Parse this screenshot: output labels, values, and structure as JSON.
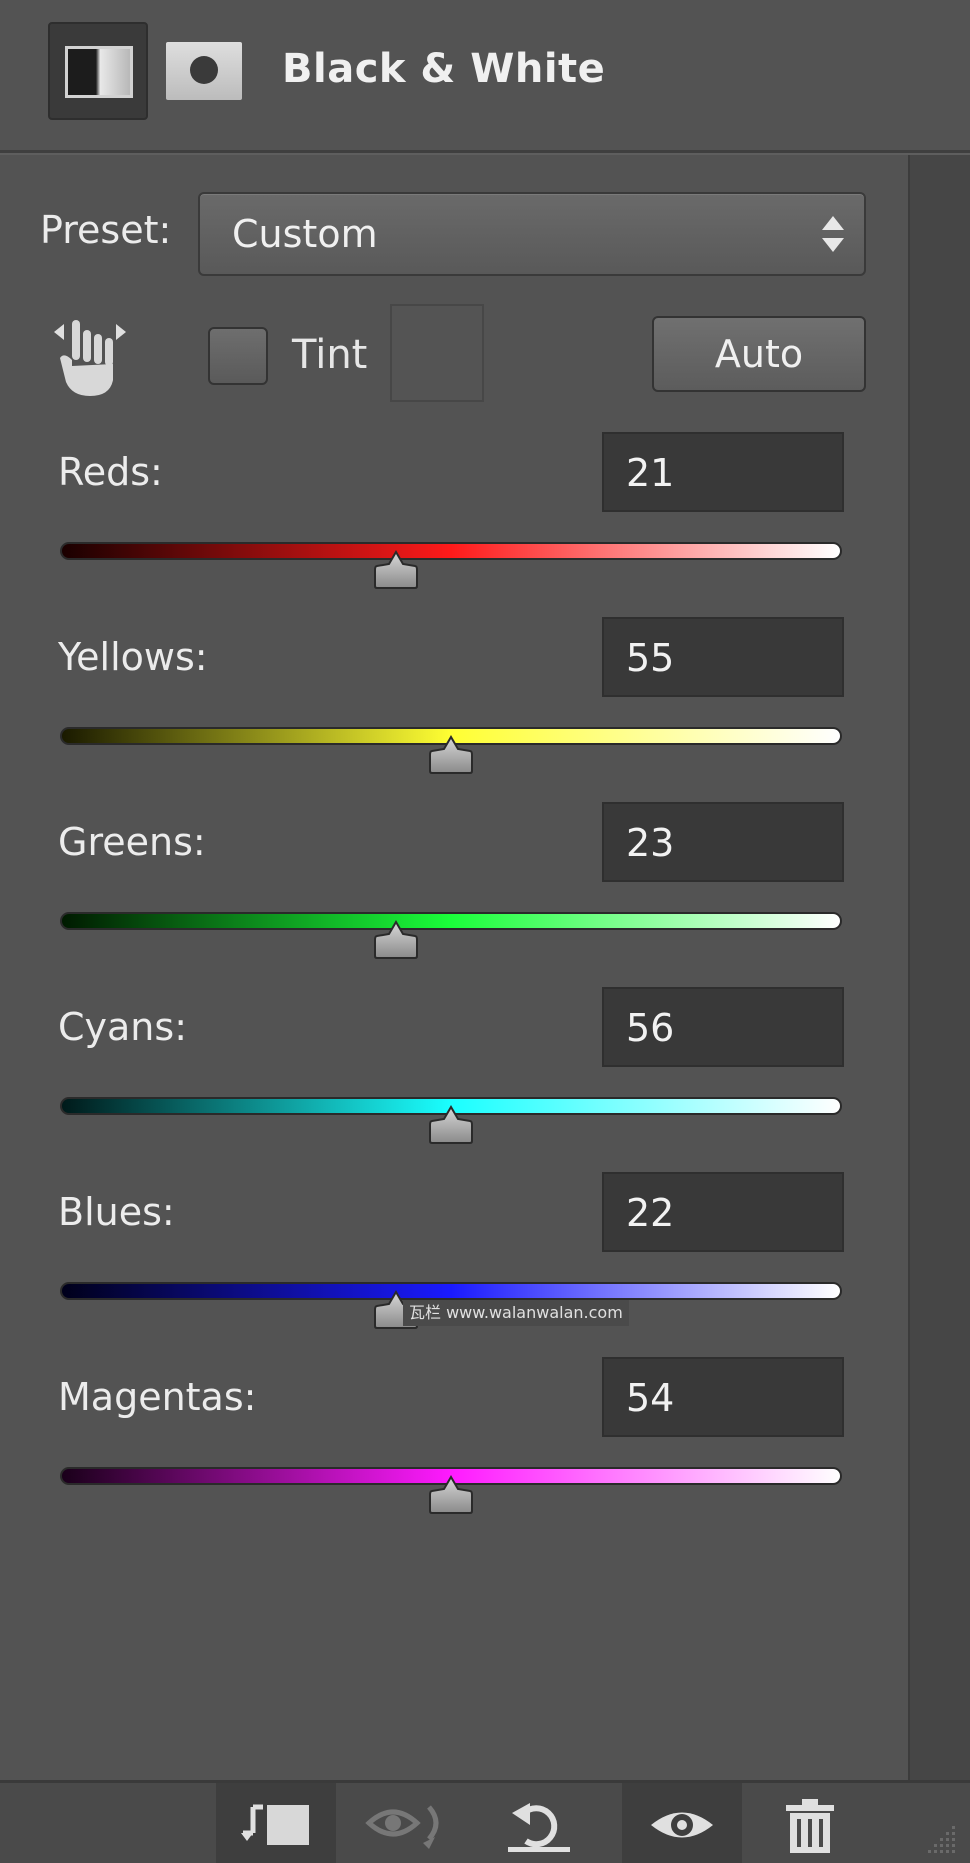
{
  "header": {
    "title": "Black & White"
  },
  "preset": {
    "label": "Preset:",
    "value": "Custom"
  },
  "tint": {
    "label": "Tint",
    "checked": false
  },
  "auto_button": {
    "label": "Auto"
  },
  "sliders": [
    {
      "label": "Reds:",
      "value": "21",
      "fraction": 0.43,
      "gradient": [
        "#1a0000",
        "#ff1a1a",
        "#ffffff"
      ]
    },
    {
      "label": "Yellows:",
      "value": "55",
      "fraction": 0.5,
      "gradient": [
        "#1a1a00",
        "#ffff33",
        "#ffffff"
      ]
    },
    {
      "label": "Greens:",
      "value": "23",
      "fraction": 0.43,
      "gradient": [
        "#001a00",
        "#1aff3a",
        "#ffffff"
      ]
    },
    {
      "label": "Cyans:",
      "value": "56",
      "fraction": 0.5,
      "gradient": [
        "#001a1a",
        "#1affff",
        "#ffffff"
      ]
    },
    {
      "label": "Blues:",
      "value": "22",
      "fraction": 0.43,
      "gradient": [
        "#00001a",
        "#1a1aff",
        "#ffffff"
      ]
    },
    {
      "label": "Magentas:",
      "value": "54",
      "fraction": 0.5,
      "gradient": [
        "#1a001a",
        "#ff1aff",
        "#ffffff"
      ]
    }
  ],
  "watermark": "瓦栏 www.walanwalan.com",
  "footer": {
    "icons": [
      "clip-to-layer-icon",
      "view-previous-icon",
      "reset-icon",
      "visibility-eye-icon",
      "trash-icon"
    ]
  }
}
